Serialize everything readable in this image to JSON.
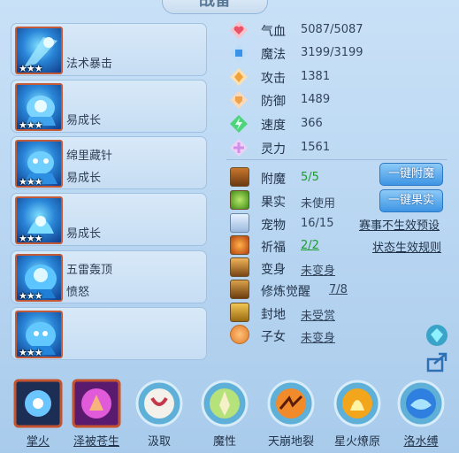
{
  "title": "战备",
  "cards": [
    {
      "line1": "",
      "line2": "法术暴击",
      "stars": "★★★"
    },
    {
      "line1": "",
      "line2": "易成长",
      "stars": "★★★"
    },
    {
      "line1": "绵里藏针",
      "line2": "易成长",
      "stars": "★★★"
    },
    {
      "line1": "",
      "line2": "易成长",
      "stars": "★★★"
    },
    {
      "line1": "五雷轰顶",
      "line2": "愤怒",
      "stars": "★★★"
    },
    {
      "line1": "",
      "line2": "",
      "stars": "★★★"
    }
  ],
  "stats": [
    {
      "label": "气血",
      "value": "5087/5087",
      "color": "#e9536a",
      "icon": "heart-gem-icon"
    },
    {
      "label": "魔法",
      "value": "3199/3199",
      "color": "#3a92e8",
      "icon": "square-gem-icon"
    },
    {
      "label": "攻击",
      "value": "1381",
      "color": "#f2a23a",
      "icon": "diamond-gem-icon"
    },
    {
      "label": "防御",
      "value": "1489",
      "color": "#f0a24a",
      "icon": "shield-gem-icon"
    },
    {
      "label": "速度",
      "value": "366",
      "color": "#37c46a",
      "icon": "bolt-gem-icon"
    },
    {
      "label": "灵力",
      "value": "1561",
      "color": "#cf8fe8",
      "icon": "cross-gem-icon"
    }
  ],
  "info": {
    "fumo": {
      "label": "附魔",
      "value": "5/5"
    },
    "guoshi": {
      "label": "果实",
      "value": "未使用"
    },
    "chongwu": {
      "label": "宠物",
      "value": "16/15"
    },
    "qifu": {
      "label": "祈福",
      "value": "2/2"
    },
    "bianshen": {
      "label": "变身",
      "value": "未变身"
    },
    "xiulian": {
      "label": "修炼觉醒",
      "value": "7/8"
    },
    "fengdi": {
      "label": "封地",
      "value": "未受赏"
    },
    "zinv": {
      "label": "子女",
      "value": "未变身"
    }
  },
  "buttons": {
    "fumo": "一键附魔",
    "guoshi": "一键果实"
  },
  "links": {
    "event_preset": "赛事不生效预设",
    "status_rule": "状态生效规则"
  },
  "skills": [
    {
      "name": "掌火",
      "icon": "palm-fire-icon",
      "underline": true
    },
    {
      "name": "泽被苍生",
      "icon": "bless-hand-icon",
      "underline": true
    },
    {
      "name": "汲取",
      "icon": "absorb-icon",
      "underline": false
    },
    {
      "name": "魔性",
      "icon": "demon-nature-icon",
      "underline": false
    },
    {
      "name": "天崩地裂",
      "icon": "earthquake-icon",
      "underline": false
    },
    {
      "name": "星火燎原",
      "icon": "prairie-fire-icon",
      "underline": false
    },
    {
      "name": "洛水缚",
      "icon": "river-bind-icon",
      "underline": true
    }
  ]
}
